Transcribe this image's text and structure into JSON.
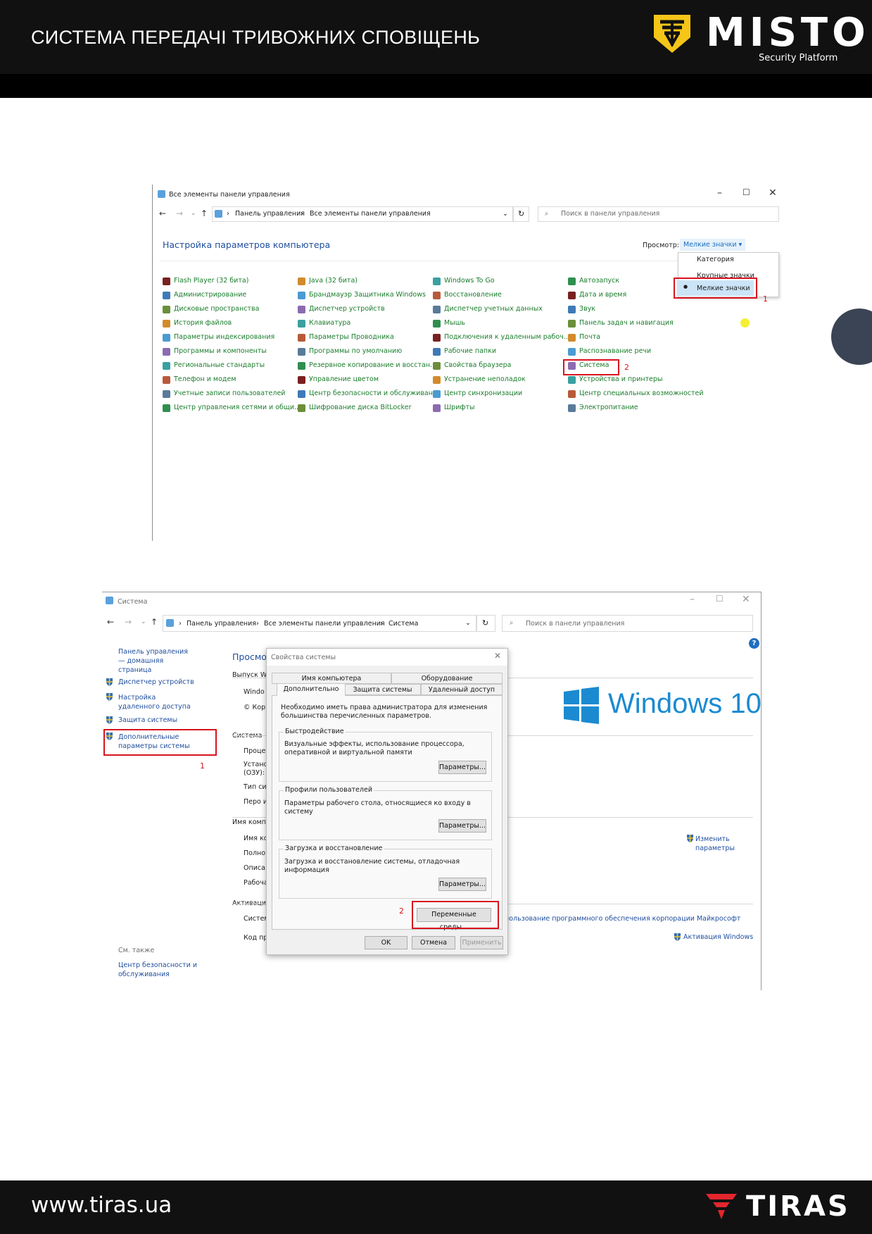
{
  "header": {
    "title": "СИСТЕМА ПЕРЕДАЧІ ТРИВОЖНИХ СПОВІЩЕНЬ",
    "brand": "MISTO",
    "brand_sub": "Security Platform"
  },
  "footer": {
    "url": "www.tiras.ua",
    "brand": "TIRAS"
  },
  "colors": {
    "dark": "#111111",
    "accent_yellow": "#f5c518",
    "link_green": "#1b7d2d",
    "link_blue": "#1f4e9e",
    "highlight_red": "#d8141d"
  },
  "shot1": {
    "window_title": "Все элементы панели управления",
    "breadcrumb": [
      "Панель управления",
      "Все элементы панели управления"
    ],
    "search_placeholder": "Поиск в панели управления",
    "page_title": "Настройка параметров компьютера",
    "view_label": "Просмотр:",
    "view_value": "Мелкие значки ▾",
    "view_menu": [
      "Категория",
      "Крупные значки",
      "Мелкие значки"
    ],
    "marker1": "1",
    "marker2": "2",
    "columns": [
      [
        "Flash Player (32 бита)",
        "Администрирование",
        "Дисковые пространства",
        "История файлов",
        "Параметры индексирования",
        "Программы и компоненты",
        "Региональные стандарты",
        "Телефон и модем",
        "Учетные записи пользователей",
        "Центр управления сетями и общи..."
      ],
      [
        "Java (32 бита)",
        "Брандмауэр Защитника Windows",
        "Диспетчер устройств",
        "Клавиатура",
        "Параметры Проводника",
        "Программы по умолчанию",
        "Резервное копирование и восстан...",
        "Управление цветом",
        "Центр безопасности и обслуживан...",
        "Шифрование диска BitLocker"
      ],
      [
        "Windows To Go",
        "Восстановление",
        "Диспетчер учетных данных",
        "Мышь",
        "Подключения к удаленным рабоч...",
        "Рабочие папки",
        "Свойства браузера",
        "Устранение неполадок",
        "Центр синхронизации",
        "Шрифты"
      ],
      [
        "Автозапуск",
        "Дата и время",
        "Звук",
        "Панель задач и навигация",
        "Почта",
        "Распознавание речи",
        "Система",
        "Устройства и принтеры",
        "Центр специальных возможностей",
        "Электропитание"
      ]
    ]
  },
  "shot2": {
    "window_title": "Система",
    "breadcrumb": [
      "Панель управления",
      "Все элементы панели управления",
      "Система"
    ],
    "search_placeholder": "Поиск в панели управления",
    "sidebar_home": "Панель управления — домашняя страница",
    "sidebar_items": [
      "Диспетчер устройств",
      "Настройка удаленного доступа",
      "Защита системы",
      "Дополнительные параметры системы"
    ],
    "see_also": "См. также",
    "see_also_item": "Центр безопасности и обслуживания",
    "marker1": "1",
    "marker2": "2",
    "main_heading": "Просмот",
    "main_rows": [
      "Выпуск W",
      "Windo",
      "© Корп",
      "Система",
      "Проце",
      "Устано (ОЗУ):",
      "Тип си",
      "Перо и",
      "Имя комп",
      "Имя ко",
      "Полно",
      "Описа",
      "Рабоча",
      "Активация",
      "Систем",
      "Код пр"
    ],
    "win10_logo": "Windows 10",
    "change_params": "Изменить параметры",
    "license_text": "пользование программного обеспечения корпорации Майкрософт",
    "activation_link": "Активация Windows",
    "dialog": {
      "title": "Свойства системы",
      "tabs_top": [
        "Имя компьютера",
        "Оборудование"
      ],
      "tabs_bottom": [
        "Дополнительно",
        "Защита системы",
        "Удаленный доступ"
      ],
      "intro": "Необходимо иметь права администратора для изменения большинства перечисленных параметров.",
      "groups": [
        {
          "title": "Быстродействие",
          "text": "Визуальные эффекты, использование процессора, оперативной и виртуальной памяти",
          "button": "Параметры..."
        },
        {
          "title": "Профили пользователей",
          "text": "Параметры рабочего стола, относящиеся ко входу в систему",
          "button": "Параметры..."
        },
        {
          "title": "Загрузка и восстановление",
          "text": "Загрузка и восстановление системы, отладочная информация",
          "button": "Параметры..."
        }
      ],
      "env_button": "Переменные среды...",
      "ok": "OK",
      "cancel": "Отмена",
      "apply": "Применить"
    }
  }
}
